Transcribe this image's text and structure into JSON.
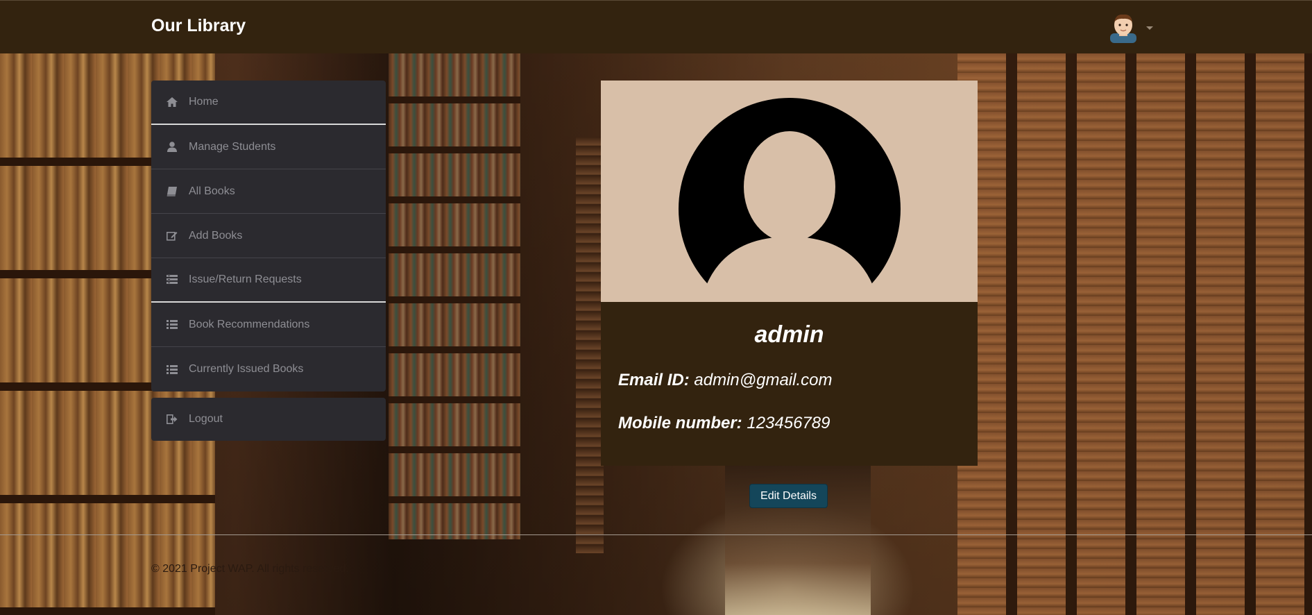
{
  "header": {
    "brand": "Our Library",
    "user_menu_icon": "user-avatar-icon"
  },
  "sidebar": {
    "items": [
      {
        "label": "Home",
        "icon": "home-icon"
      },
      {
        "label": "Manage Students",
        "icon": "user-icon"
      },
      {
        "label": "All Books",
        "icon": "book-icon"
      },
      {
        "label": "Add Books",
        "icon": "edit-icon"
      },
      {
        "label": "Issue/Return Requests",
        "icon": "list-alt-icon"
      },
      {
        "label": "Book Recommendations",
        "icon": "list-icon"
      },
      {
        "label": "Currently Issued Books",
        "icon": "list-icon"
      }
    ],
    "logout": {
      "label": "Logout",
      "icon": "logout-icon"
    }
  },
  "profile": {
    "name": "admin",
    "email_label": "Email ID:",
    "email": "admin@gmail.com",
    "mobile_label": "Mobile number:",
    "mobile": "123456789",
    "edit_label": "Edit Details"
  },
  "footer": {
    "text": "© 2021 Project WAP. All rights reserved."
  },
  "colors": {
    "navbar": "#33230f",
    "sidebar": "#2b2a2f",
    "photo_bg": "#d8bfa8",
    "card_body": "#33230f",
    "button": "#14465a"
  }
}
